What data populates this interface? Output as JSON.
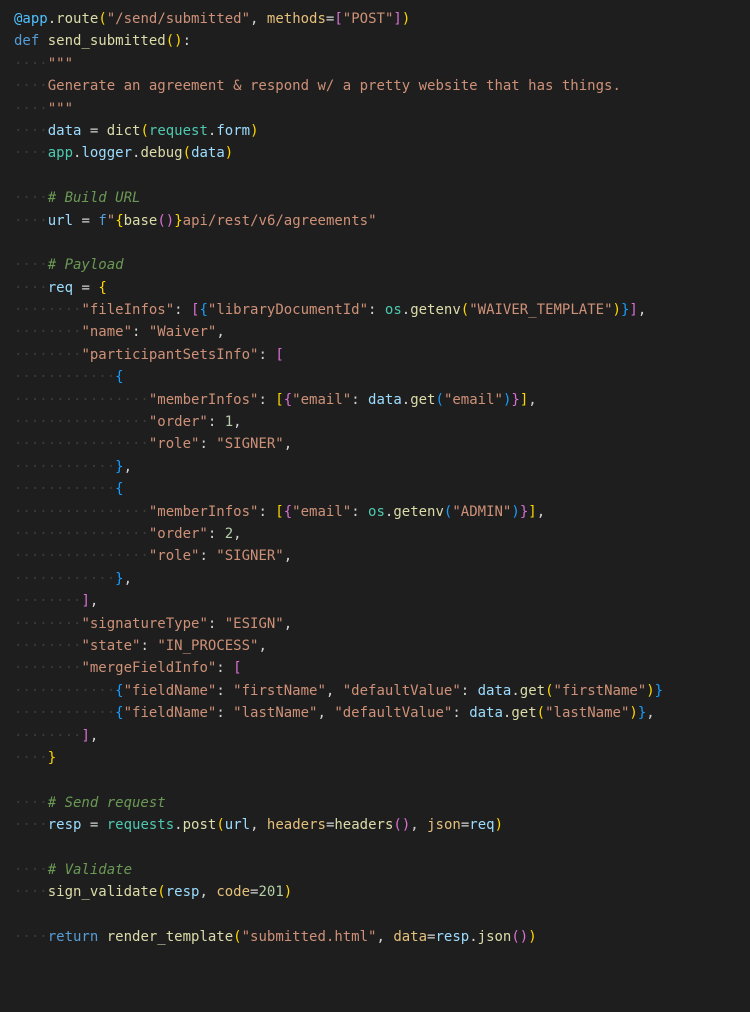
{
  "lines": [
    [
      {
        "cls": "decorator",
        "text": "@app"
      },
      {
        "cls": "punct",
        "text": "."
      },
      {
        "cls": "func",
        "text": "route"
      },
      {
        "cls": "bracket1",
        "text": "("
      },
      {
        "cls": "string",
        "text": "\"/send/submitted\""
      },
      {
        "cls": "punct",
        "text": ", "
      },
      {
        "cls": "param",
        "text": "methods"
      },
      {
        "cls": "punct",
        "text": "="
      },
      {
        "cls": "bracket2",
        "text": "["
      },
      {
        "cls": "string",
        "text": "\"POST\""
      },
      {
        "cls": "bracket2",
        "text": "]"
      },
      {
        "cls": "bracket1",
        "text": ")"
      }
    ],
    [
      {
        "cls": "keyword",
        "text": "def "
      },
      {
        "cls": "func",
        "text": "send_submitted"
      },
      {
        "cls": "bracket1",
        "text": "("
      },
      {
        "cls": "bracket1",
        "text": ")"
      },
      {
        "cls": "punct",
        "text": ":"
      }
    ],
    [
      {
        "cls": "whitespace",
        "text": "····"
      },
      {
        "cls": "docstring",
        "text": "\"\"\""
      }
    ],
    [
      {
        "cls": "whitespace",
        "text": "····"
      },
      {
        "cls": "docstring",
        "text": "Generate an agreement & respond w/ a pretty website that has things."
      }
    ],
    [
      {
        "cls": "whitespace",
        "text": "····"
      },
      {
        "cls": "docstring",
        "text": "\"\"\""
      }
    ],
    [
      {
        "cls": "whitespace",
        "text": "····"
      },
      {
        "cls": "variable",
        "text": "data"
      },
      {
        "cls": "punct",
        "text": " = "
      },
      {
        "cls": "func",
        "text": "dict"
      },
      {
        "cls": "bracket1",
        "text": "("
      },
      {
        "cls": "module",
        "text": "request"
      },
      {
        "cls": "punct",
        "text": "."
      },
      {
        "cls": "variable",
        "text": "form"
      },
      {
        "cls": "bracket1",
        "text": ")"
      }
    ],
    [
      {
        "cls": "whitespace",
        "text": "····"
      },
      {
        "cls": "module",
        "text": "app"
      },
      {
        "cls": "punct",
        "text": "."
      },
      {
        "cls": "variable",
        "text": "logger"
      },
      {
        "cls": "punct",
        "text": "."
      },
      {
        "cls": "func",
        "text": "debug"
      },
      {
        "cls": "bracket1",
        "text": "("
      },
      {
        "cls": "variable",
        "text": "data"
      },
      {
        "cls": "bracket1",
        "text": ")"
      }
    ],
    [
      {
        "cls": "plain",
        "text": " "
      }
    ],
    [
      {
        "cls": "whitespace",
        "text": "····"
      },
      {
        "cls": "comment",
        "text": "# Build URL"
      }
    ],
    [
      {
        "cls": "whitespace",
        "text": "····"
      },
      {
        "cls": "variable",
        "text": "url"
      },
      {
        "cls": "punct",
        "text": " = "
      },
      {
        "cls": "keyword",
        "text": "f"
      },
      {
        "cls": "string",
        "text": "\""
      },
      {
        "cls": "bracket1",
        "text": "{"
      },
      {
        "cls": "func",
        "text": "base"
      },
      {
        "cls": "bracket2",
        "text": "("
      },
      {
        "cls": "bracket2",
        "text": ")"
      },
      {
        "cls": "bracket1",
        "text": "}"
      },
      {
        "cls": "string",
        "text": "api/rest/v6/agreements\""
      }
    ],
    [
      {
        "cls": "plain",
        "text": " "
      }
    ],
    [
      {
        "cls": "whitespace",
        "text": "····"
      },
      {
        "cls": "comment",
        "text": "# Payload"
      }
    ],
    [
      {
        "cls": "whitespace",
        "text": "····"
      },
      {
        "cls": "variable",
        "text": "req"
      },
      {
        "cls": "punct",
        "text": " = "
      },
      {
        "cls": "bracket1",
        "text": "{"
      }
    ],
    [
      {
        "cls": "whitespace",
        "text": "········"
      },
      {
        "cls": "string",
        "text": "\"fileInfos\""
      },
      {
        "cls": "punct",
        "text": ": "
      },
      {
        "cls": "bracket2",
        "text": "["
      },
      {
        "cls": "bracket3",
        "text": "{"
      },
      {
        "cls": "string",
        "text": "\"libraryDocumentId\""
      },
      {
        "cls": "punct",
        "text": ": "
      },
      {
        "cls": "module",
        "text": "os"
      },
      {
        "cls": "punct",
        "text": "."
      },
      {
        "cls": "func",
        "text": "getenv"
      },
      {
        "cls": "bracket1",
        "text": "("
      },
      {
        "cls": "string",
        "text": "\"WAIVER_TEMPLATE\""
      },
      {
        "cls": "bracket1",
        "text": ")"
      },
      {
        "cls": "bracket3",
        "text": "}"
      },
      {
        "cls": "bracket2",
        "text": "]"
      },
      {
        "cls": "punct",
        "text": ","
      }
    ],
    [
      {
        "cls": "whitespace",
        "text": "········"
      },
      {
        "cls": "string",
        "text": "\"name\""
      },
      {
        "cls": "punct",
        "text": ": "
      },
      {
        "cls": "string",
        "text": "\"Waiver\""
      },
      {
        "cls": "punct",
        "text": ","
      }
    ],
    [
      {
        "cls": "whitespace",
        "text": "········"
      },
      {
        "cls": "string",
        "text": "\"participantSetsInfo\""
      },
      {
        "cls": "punct",
        "text": ": "
      },
      {
        "cls": "bracket2",
        "text": "["
      }
    ],
    [
      {
        "cls": "whitespace",
        "text": "············"
      },
      {
        "cls": "bracket3",
        "text": "{"
      }
    ],
    [
      {
        "cls": "whitespace",
        "text": "················"
      },
      {
        "cls": "string",
        "text": "\"memberInfos\""
      },
      {
        "cls": "punct",
        "text": ": "
      },
      {
        "cls": "bracket1",
        "text": "["
      },
      {
        "cls": "bracket2",
        "text": "{"
      },
      {
        "cls": "string",
        "text": "\"email\""
      },
      {
        "cls": "punct",
        "text": ": "
      },
      {
        "cls": "variable",
        "text": "data"
      },
      {
        "cls": "punct",
        "text": "."
      },
      {
        "cls": "func",
        "text": "get"
      },
      {
        "cls": "bracket3",
        "text": "("
      },
      {
        "cls": "string",
        "text": "\"email\""
      },
      {
        "cls": "bracket3",
        "text": ")"
      },
      {
        "cls": "bracket2",
        "text": "}"
      },
      {
        "cls": "bracket1",
        "text": "]"
      },
      {
        "cls": "punct",
        "text": ","
      }
    ],
    [
      {
        "cls": "whitespace",
        "text": "················"
      },
      {
        "cls": "string",
        "text": "\"order\""
      },
      {
        "cls": "punct",
        "text": ": "
      },
      {
        "cls": "number",
        "text": "1"
      },
      {
        "cls": "punct",
        "text": ","
      }
    ],
    [
      {
        "cls": "whitespace",
        "text": "················"
      },
      {
        "cls": "string",
        "text": "\"role\""
      },
      {
        "cls": "punct",
        "text": ": "
      },
      {
        "cls": "string",
        "text": "\"SIGNER\""
      },
      {
        "cls": "punct",
        "text": ","
      }
    ],
    [
      {
        "cls": "whitespace",
        "text": "············"
      },
      {
        "cls": "bracket3",
        "text": "}"
      },
      {
        "cls": "punct",
        "text": ","
      }
    ],
    [
      {
        "cls": "whitespace",
        "text": "············"
      },
      {
        "cls": "bracket3",
        "text": "{"
      }
    ],
    [
      {
        "cls": "whitespace",
        "text": "················"
      },
      {
        "cls": "string",
        "text": "\"memberInfos\""
      },
      {
        "cls": "punct",
        "text": ": "
      },
      {
        "cls": "bracket1",
        "text": "["
      },
      {
        "cls": "bracket2",
        "text": "{"
      },
      {
        "cls": "string",
        "text": "\"email\""
      },
      {
        "cls": "punct",
        "text": ": "
      },
      {
        "cls": "module",
        "text": "os"
      },
      {
        "cls": "punct",
        "text": "."
      },
      {
        "cls": "func",
        "text": "getenv"
      },
      {
        "cls": "bracket3",
        "text": "("
      },
      {
        "cls": "string",
        "text": "\"ADMIN\""
      },
      {
        "cls": "bracket3",
        "text": ")"
      },
      {
        "cls": "bracket2",
        "text": "}"
      },
      {
        "cls": "bracket1",
        "text": "]"
      },
      {
        "cls": "punct",
        "text": ","
      }
    ],
    [
      {
        "cls": "whitespace",
        "text": "················"
      },
      {
        "cls": "string",
        "text": "\"order\""
      },
      {
        "cls": "punct",
        "text": ": "
      },
      {
        "cls": "number",
        "text": "2"
      },
      {
        "cls": "punct",
        "text": ","
      }
    ],
    [
      {
        "cls": "whitespace",
        "text": "················"
      },
      {
        "cls": "string",
        "text": "\"role\""
      },
      {
        "cls": "punct",
        "text": ": "
      },
      {
        "cls": "string",
        "text": "\"SIGNER\""
      },
      {
        "cls": "punct",
        "text": ","
      }
    ],
    [
      {
        "cls": "whitespace",
        "text": "············"
      },
      {
        "cls": "bracket3",
        "text": "}"
      },
      {
        "cls": "punct",
        "text": ","
      }
    ],
    [
      {
        "cls": "whitespace",
        "text": "········"
      },
      {
        "cls": "bracket2",
        "text": "]"
      },
      {
        "cls": "punct",
        "text": ","
      }
    ],
    [
      {
        "cls": "whitespace",
        "text": "········"
      },
      {
        "cls": "string",
        "text": "\"signatureType\""
      },
      {
        "cls": "punct",
        "text": ": "
      },
      {
        "cls": "string",
        "text": "\"ESIGN\""
      },
      {
        "cls": "punct",
        "text": ","
      }
    ],
    [
      {
        "cls": "whitespace",
        "text": "········"
      },
      {
        "cls": "string",
        "text": "\"state\""
      },
      {
        "cls": "punct",
        "text": ": "
      },
      {
        "cls": "string",
        "text": "\"IN_PROCESS\""
      },
      {
        "cls": "punct",
        "text": ","
      }
    ],
    [
      {
        "cls": "whitespace",
        "text": "········"
      },
      {
        "cls": "string",
        "text": "\"mergeFieldInfo\""
      },
      {
        "cls": "punct",
        "text": ": "
      },
      {
        "cls": "bracket2",
        "text": "["
      }
    ],
    [
      {
        "cls": "whitespace",
        "text": "············"
      },
      {
        "cls": "bracket3",
        "text": "{"
      },
      {
        "cls": "string",
        "text": "\"fieldName\""
      },
      {
        "cls": "punct",
        "text": ": "
      },
      {
        "cls": "string",
        "text": "\"firstName\""
      },
      {
        "cls": "punct",
        "text": ", "
      },
      {
        "cls": "string",
        "text": "\"defaultValue\""
      },
      {
        "cls": "punct",
        "text": ": "
      },
      {
        "cls": "variable",
        "text": "data"
      },
      {
        "cls": "punct",
        "text": "."
      },
      {
        "cls": "func",
        "text": "get"
      },
      {
        "cls": "bracket1",
        "text": "("
      },
      {
        "cls": "string",
        "text": "\"firstName\""
      },
      {
        "cls": "bracket1",
        "text": ")"
      },
      {
        "cls": "bracket3",
        "text": "}"
      }
    ],
    [
      {
        "cls": "whitespace",
        "text": "············"
      },
      {
        "cls": "bracket3",
        "text": "{"
      },
      {
        "cls": "string",
        "text": "\"fieldName\""
      },
      {
        "cls": "punct",
        "text": ": "
      },
      {
        "cls": "string",
        "text": "\"lastName\""
      },
      {
        "cls": "punct",
        "text": ", "
      },
      {
        "cls": "string",
        "text": "\"defaultValue\""
      },
      {
        "cls": "punct",
        "text": ": "
      },
      {
        "cls": "variable",
        "text": "data"
      },
      {
        "cls": "punct",
        "text": "."
      },
      {
        "cls": "func",
        "text": "get"
      },
      {
        "cls": "bracket1",
        "text": "("
      },
      {
        "cls": "string",
        "text": "\"lastName\""
      },
      {
        "cls": "bracket1",
        "text": ")"
      },
      {
        "cls": "bracket3",
        "text": "}"
      },
      {
        "cls": "punct",
        "text": ","
      }
    ],
    [
      {
        "cls": "whitespace",
        "text": "········"
      },
      {
        "cls": "bracket2",
        "text": "]"
      },
      {
        "cls": "punct",
        "text": ","
      }
    ],
    [
      {
        "cls": "whitespace",
        "text": "····"
      },
      {
        "cls": "bracket1",
        "text": "}"
      }
    ],
    [
      {
        "cls": "plain",
        "text": " "
      }
    ],
    [
      {
        "cls": "whitespace",
        "text": "····"
      },
      {
        "cls": "comment",
        "text": "# Send request"
      }
    ],
    [
      {
        "cls": "whitespace",
        "text": "····"
      },
      {
        "cls": "variable",
        "text": "resp"
      },
      {
        "cls": "punct",
        "text": " = "
      },
      {
        "cls": "module",
        "text": "requests"
      },
      {
        "cls": "punct",
        "text": "."
      },
      {
        "cls": "func",
        "text": "post"
      },
      {
        "cls": "bracket1",
        "text": "("
      },
      {
        "cls": "variable",
        "text": "url"
      },
      {
        "cls": "punct",
        "text": ", "
      },
      {
        "cls": "param",
        "text": "headers"
      },
      {
        "cls": "punct",
        "text": "="
      },
      {
        "cls": "func",
        "text": "headers"
      },
      {
        "cls": "bracket2",
        "text": "("
      },
      {
        "cls": "bracket2",
        "text": ")"
      },
      {
        "cls": "punct",
        "text": ", "
      },
      {
        "cls": "param",
        "text": "json"
      },
      {
        "cls": "punct",
        "text": "="
      },
      {
        "cls": "variable",
        "text": "req"
      },
      {
        "cls": "bracket1",
        "text": ")"
      }
    ],
    [
      {
        "cls": "plain",
        "text": " "
      }
    ],
    [
      {
        "cls": "whitespace",
        "text": "····"
      },
      {
        "cls": "comment",
        "text": "# Validate"
      }
    ],
    [
      {
        "cls": "whitespace",
        "text": "····"
      },
      {
        "cls": "func",
        "text": "sign_validate"
      },
      {
        "cls": "bracket1",
        "text": "("
      },
      {
        "cls": "variable",
        "text": "resp"
      },
      {
        "cls": "punct",
        "text": ", "
      },
      {
        "cls": "param",
        "text": "code"
      },
      {
        "cls": "punct",
        "text": "="
      },
      {
        "cls": "number",
        "text": "201"
      },
      {
        "cls": "bracket1",
        "text": ")"
      }
    ],
    [
      {
        "cls": "plain",
        "text": " "
      }
    ],
    [
      {
        "cls": "whitespace",
        "text": "····"
      },
      {
        "cls": "keyword",
        "text": "return "
      },
      {
        "cls": "func",
        "text": "render_template"
      },
      {
        "cls": "bracket1",
        "text": "("
      },
      {
        "cls": "string",
        "text": "\"submitted.html\""
      },
      {
        "cls": "punct",
        "text": ", "
      },
      {
        "cls": "param",
        "text": "data"
      },
      {
        "cls": "punct",
        "text": "="
      },
      {
        "cls": "variable",
        "text": "resp"
      },
      {
        "cls": "punct",
        "text": "."
      },
      {
        "cls": "func",
        "text": "json"
      },
      {
        "cls": "bracket2",
        "text": "("
      },
      {
        "cls": "bracket2",
        "text": ")"
      },
      {
        "cls": "bracket1",
        "text": ")"
      }
    ]
  ]
}
